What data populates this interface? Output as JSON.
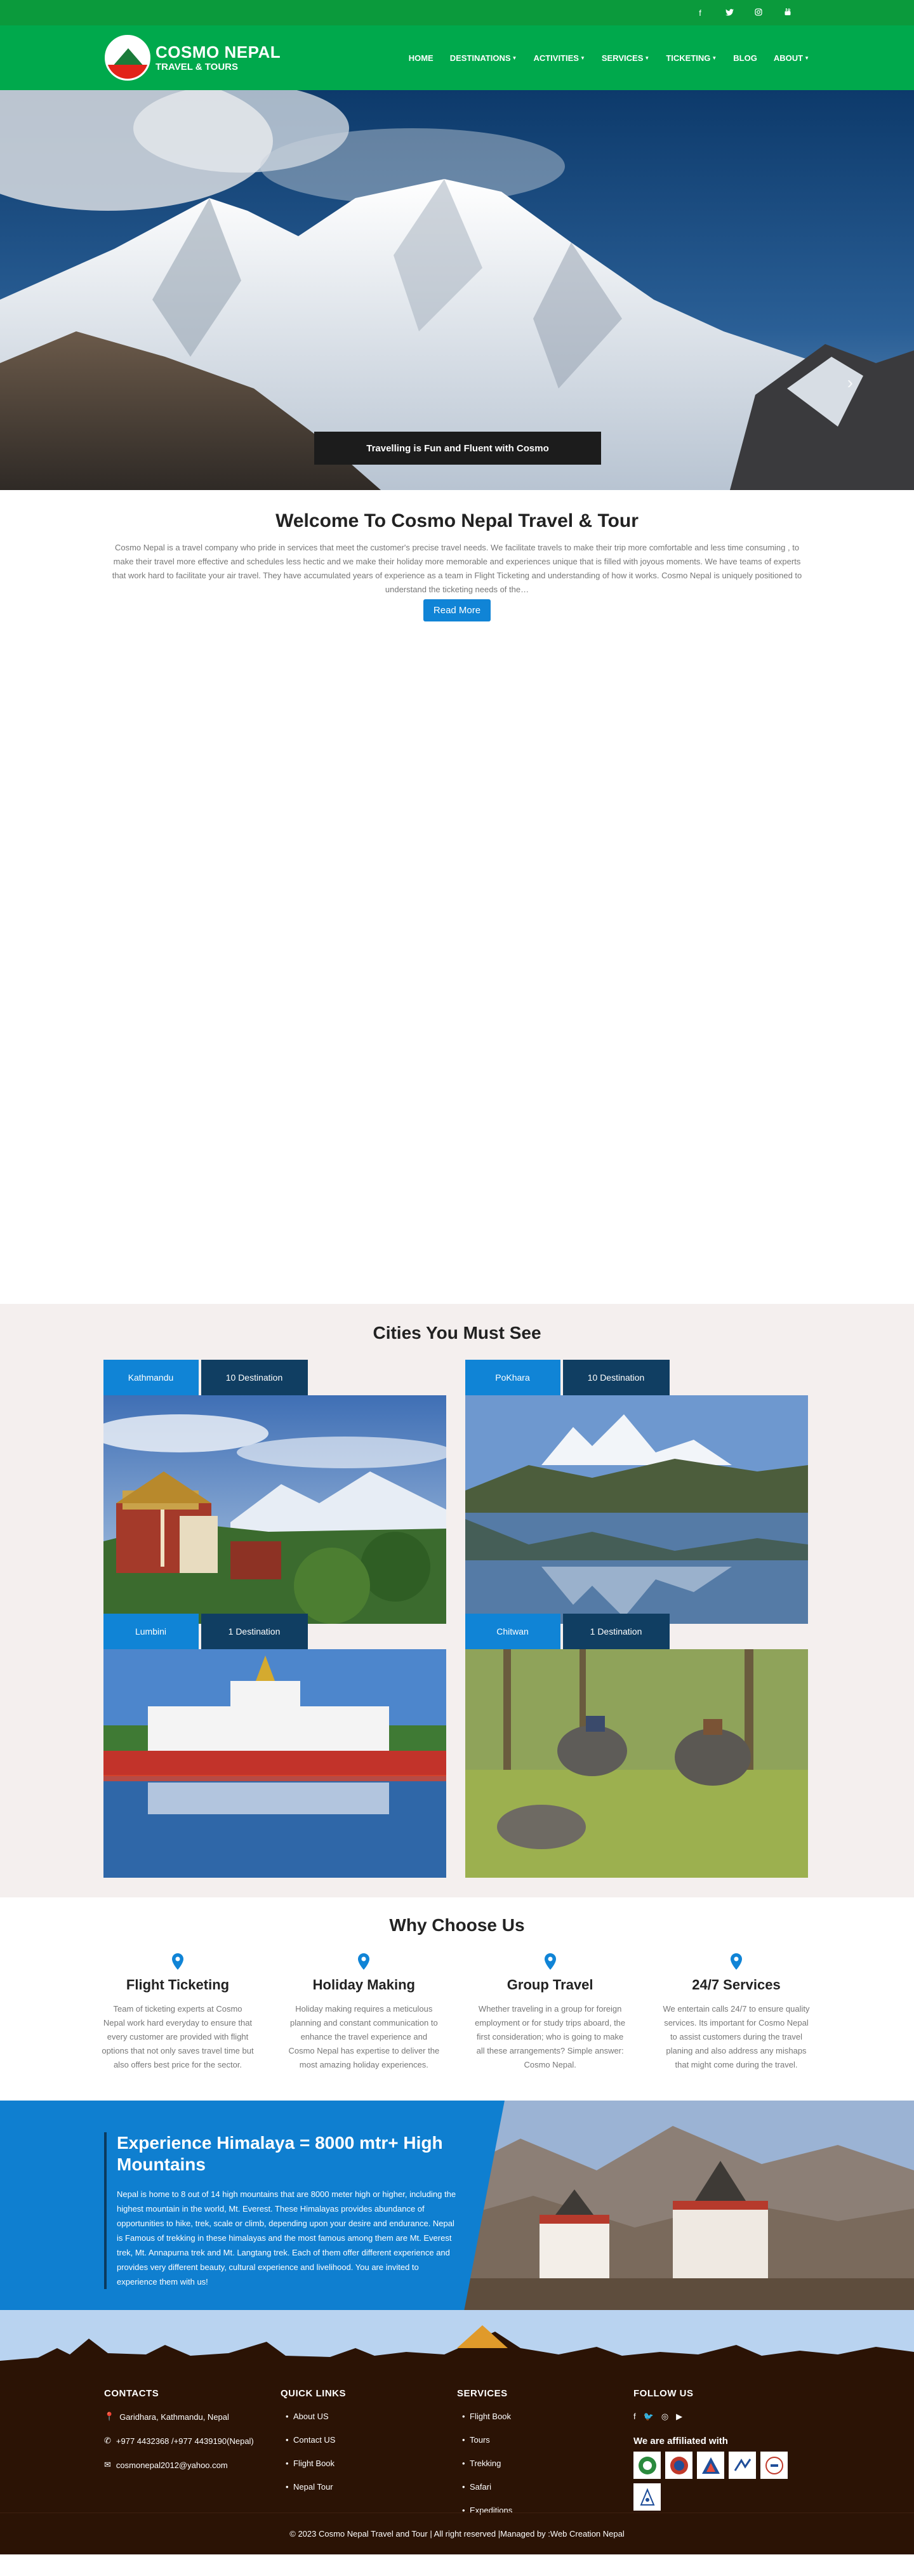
{
  "topbar": {
    "social_icons": [
      {
        "icon": "facebook-icon",
        "glyph": "f"
      },
      {
        "icon": "twitter-icon",
        "glyph": "🐦"
      },
      {
        "icon": "instagram-icon",
        "glyph": "◎"
      },
      {
        "icon": "youtube-icon",
        "glyph": "▶"
      }
    ]
  },
  "header": {
    "logo_line1": "COSMO NEPAL",
    "logo_line2": "TRAVEL & TOURS",
    "nav": [
      {
        "label": "HOME",
        "dropdown": false
      },
      {
        "label": "DESTINATIONS",
        "dropdown": true
      },
      {
        "label": "ACTIVITIES",
        "dropdown": true
      },
      {
        "label": "SERVICES",
        "dropdown": true
      },
      {
        "label": "TICKETING",
        "dropdown": true
      },
      {
        "label": "BLOG",
        "dropdown": false
      },
      {
        "label": "ABOUT",
        "dropdown": true
      }
    ]
  },
  "hero": {
    "caption": "Travelling is Fun and Fluent with Cosmo",
    "next_arrow": "›"
  },
  "welcome": {
    "title": "Welcome To Cosmo Nepal Travel & Tour",
    "body": "Cosmo Nepal is a travel company who pride in services that meet the customer's precise travel needs. We facilitate travels to make their trip more comfortable and less time consuming , to make their travel more effective and schedules less hectic and we make their holiday more memorable and experiences unique that is filled with joyous moments. We have teams of experts that work hard to facilitate your air travel. They have accumulated years of experience as a team in Flight Ticketing and understanding of how it works. Cosmo Nepal is uniquely positioned to understand the ticketing needs of the…",
    "button": "Read More"
  },
  "cities": {
    "title": "Cities You Must See",
    "items": [
      {
        "name": "Kathmandu",
        "count": "10 Destination"
      },
      {
        "name": "PoKhara",
        "count": "10 Destination"
      },
      {
        "name": "Lumbini",
        "count": "1 Destination"
      },
      {
        "name": "Chitwan",
        "count": "1 Destination"
      }
    ]
  },
  "why": {
    "title": "Why Choose Us",
    "items": [
      {
        "title": "Flight Ticketing",
        "text": "Team of ticketing experts at Cosmo Nepal work hard everyday to ensure that every customer are provided with flight options that not only saves travel time but also offers best price for the sector."
      },
      {
        "title": "Holiday Making",
        "text": "Holiday making requires a meticulous planning and constant communication to enhance the travel experience and Cosmo Nepal has expertise to deliver the most amazing holiday experiences."
      },
      {
        "title": "Group Travel",
        "text": "Whether traveling in a group for foreign employment or for study trips aboard, the first consideration; who is going to make all these arrangements? Simple answer: Cosmo Nepal."
      },
      {
        "title": "24/7 Services",
        "text": "We entertain calls 24/7 to ensure quality services. Its important for Cosmo Nepal to assist customers during the travel planing and also address any mishaps that might come during the travel."
      }
    ]
  },
  "himalaya": {
    "title": "Experience Himalaya = 8000 mtr+ High Mountains",
    "body": "Nepal is home to 8 out of 14 high mountains that are 8000 meter high or higher, including the highest mountain in the world, Mt. Everest. These Himalayas provides abundance of opportunities to hike, trek, scale or climb, depending upon your desire and endurance. Nepal is Famous of trekking in these himalayas and the most famous among them are Mt. Everest trek, Mt. Annapurna trek and Mt. Langtang trek. Each of them offer different experience and provides very different beauty, cultural experience and livelihood. You are invited to experience them with us!"
  },
  "footer": {
    "contacts": {
      "title": "CONTACTS",
      "address": "Garidhara, Kathmandu, Nepal",
      "phone": "+977 4432368 /+977 4439190(Nepal)",
      "email": "cosmonepal2012@yahoo.com"
    },
    "quick_links": {
      "title": "QUICK LINKS",
      "items": [
        "About US",
        "Contact US",
        "Flight Book",
        "Nepal Tour"
      ]
    },
    "services": {
      "title": "SERVICES",
      "items": [
        "Flight Book",
        "Tours",
        "Trekking",
        "Safari",
        "Expeditions"
      ]
    },
    "follow": {
      "title": "FOLLOW US",
      "affiliated_title": "We are affiliated with",
      "logos": [
        "nta-logo",
        "nepal-gov-logo",
        "taan-logo",
        "natta-logo",
        "iata-logo",
        "nma-logo"
      ]
    },
    "copyright": "© 2023 Cosmo Nepal Travel and Tour | All right reserved |Managed by :Web Creation Nepal"
  }
}
